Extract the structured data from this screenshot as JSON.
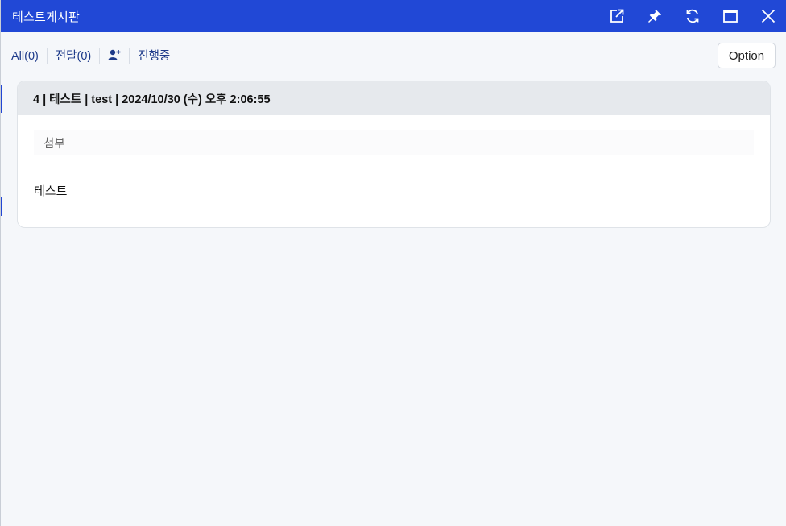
{
  "window": {
    "title": "테스트게시판",
    "title_icons": [
      "external-link-icon",
      "pin-icon",
      "refresh-icon",
      "maximize-icon",
      "close-icon"
    ]
  },
  "toolbar": {
    "all_label": "All(0)",
    "forward_label": "전달(0)",
    "add_user_icon": "add-user-icon",
    "in_progress_label": "진행중",
    "option_label": "Option"
  },
  "post": {
    "header": "4 | 테스트 | test | 2024/10/30 (수) 오후 2:06:55",
    "attachment_label": "첨부",
    "body": "테스트"
  },
  "colors": {
    "titlebar": "#2148d6",
    "link": "#1d3a8a",
    "card_header": "#e6e9ed",
    "background": "#f5f7fa"
  }
}
